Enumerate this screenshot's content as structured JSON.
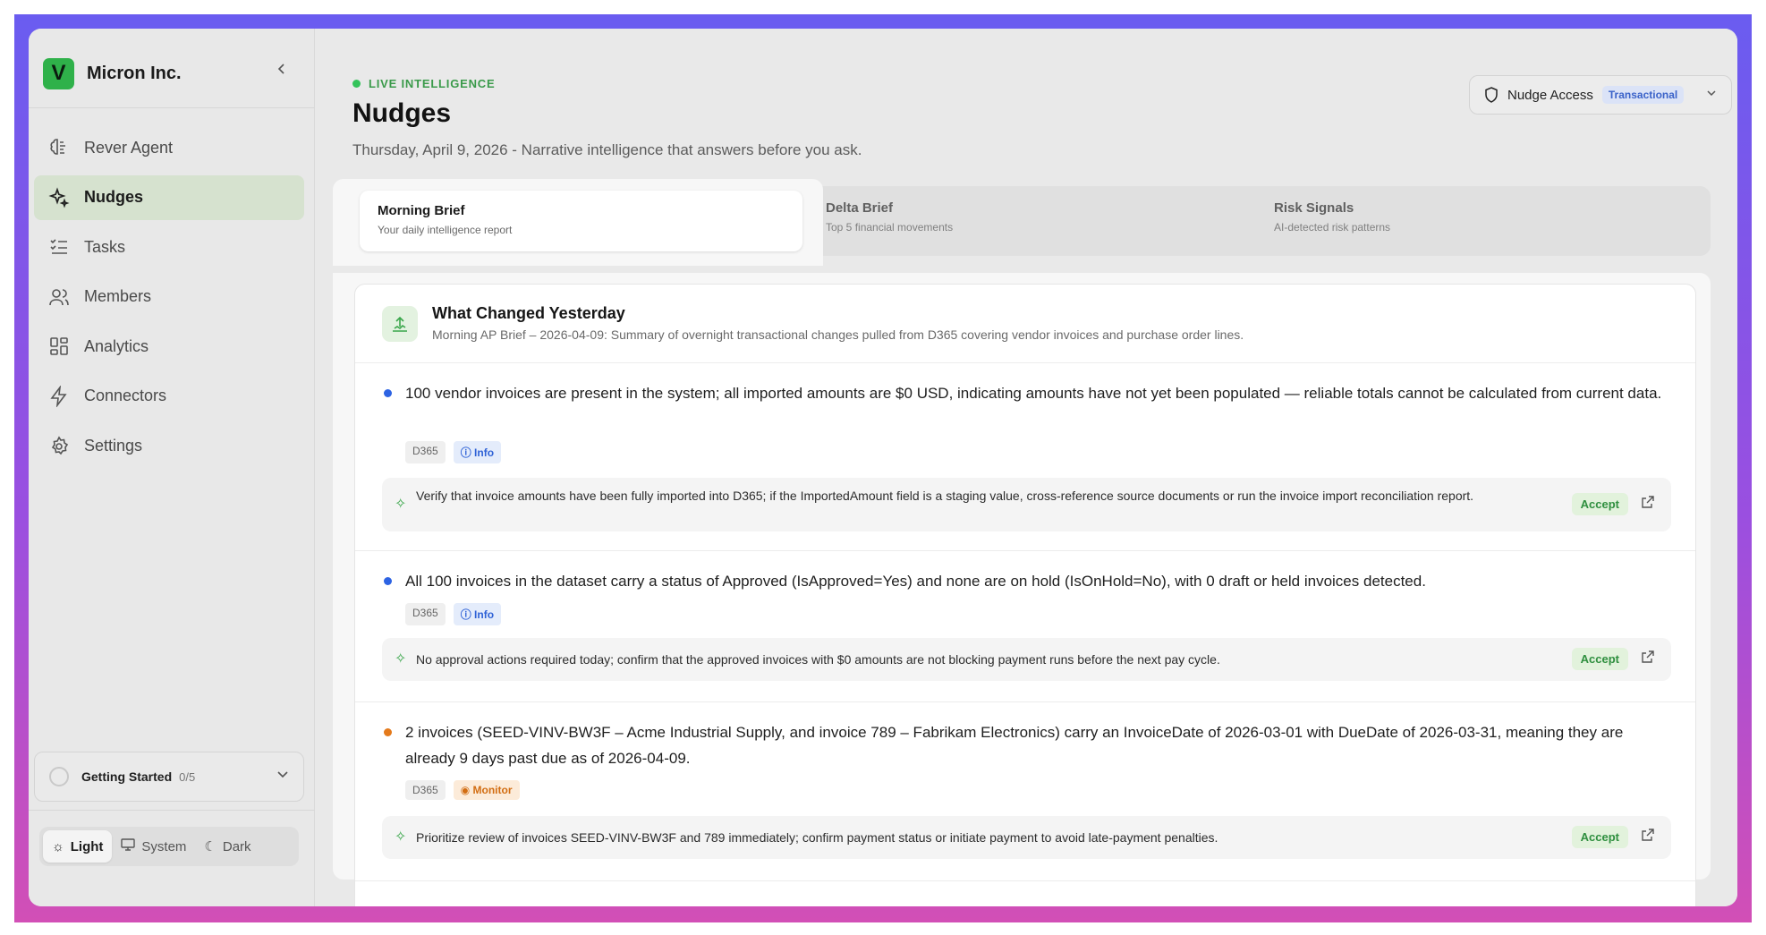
{
  "sidebar": {
    "brand_initial": "V",
    "brand_name": "Micron Inc.",
    "collapse_icon": "chevron-left-icon",
    "items": [
      {
        "label": "Rever Agent",
        "icon": "brain-icon",
        "active": false
      },
      {
        "label": "Nudges",
        "icon": "sparkles-icon",
        "active": true
      },
      {
        "label": "Tasks",
        "icon": "list-checks-icon",
        "active": false
      },
      {
        "label": "Members",
        "icon": "users-icon",
        "active": false
      },
      {
        "label": "Analytics",
        "icon": "grid-icon",
        "active": false
      },
      {
        "label": "Connectors",
        "icon": "bolt-icon",
        "active": false
      },
      {
        "label": "Settings",
        "icon": "gear-icon",
        "active": false
      }
    ],
    "getting_started": {
      "label": "Getting Started",
      "count": "0/5"
    },
    "theme": {
      "light": "Light",
      "system": "System",
      "dark": "Dark",
      "selected": "Light"
    }
  },
  "header": {
    "live_label": "LIVE INTELLIGENCE",
    "title": "Nudges",
    "subtitle": "Thursday, April 9, 2026 - Narrative intelligence that answers before you ask.",
    "access": {
      "label": "Nudge Access",
      "badge": "Transactional"
    }
  },
  "tabs": [
    {
      "title": "Morning Brief",
      "desc": "Your daily intelligence report",
      "active": true
    },
    {
      "title": "Delta Brief",
      "desc": "Top 5 financial movements",
      "active": false
    },
    {
      "title": "Risk Signals",
      "desc": "AI-detected risk patterns",
      "active": false
    }
  ],
  "card": {
    "title": "What Changed Yesterday",
    "subtitle": "Morning AP Brief – 2026-04-09: Summary of overnight transactional changes pulled from D365 covering vendor invoices and purchase order lines.",
    "items": [
      {
        "text": "100 vendor invoices are present in the system; all imported amounts are $0 USD, indicating amounts have not yet been populated — reliable totals cannot be calculated from current data.",
        "source": "D365",
        "level": "Info",
        "action": "Verify that invoice amounts have been fully imported into D365; if the ImportedAmount field is a staging value, cross-reference source documents or run the invoice import reconciliation report.",
        "accept": "Accept"
      },
      {
        "text": "All 100 invoices in the dataset carry a status of Approved (IsApproved=Yes) and none are on hold (IsOnHold=No), with 0 draft or held invoices detected.",
        "source": "D365",
        "level": "Info",
        "action": "No approval actions required today; confirm that the approved invoices with $0 amounts are not blocking payment runs before the next pay cycle.",
        "accept": "Accept"
      },
      {
        "text": "2 invoices (SEED-VINV-BW3F – Acme Industrial Supply, and invoice 789 – Fabrikam Electronics) carry an InvoiceDate of 2026-03-01 with DueDate of 2026-03-31, meaning they are already 9 days past due as of 2026-04-09.",
        "source": "D365",
        "level": "Monitor",
        "action": "Prioritize review of invoices SEED-VINV-BW3F and 789 immediately; confirm payment status or initiate payment to avoid late-payment penalties.",
        "accept": "Accept"
      }
    ]
  },
  "colors": {
    "accent_green": "#2fb14a",
    "info_blue": "#2f62d6",
    "monitor_orange": "#d26d12",
    "frame_gradient_top": "#6a5cf0",
    "frame_gradient_bottom": "#d24fb6"
  }
}
